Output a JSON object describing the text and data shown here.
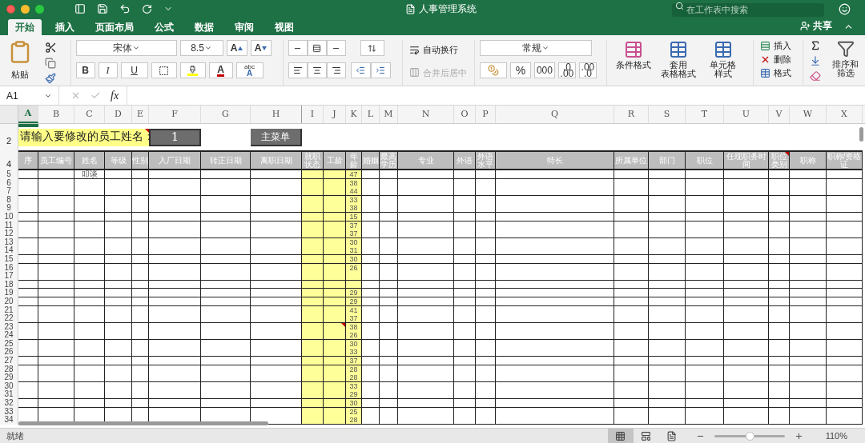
{
  "window": {
    "title": "人事管理系统"
  },
  "search": {
    "placeholder": "在工作表中搜索"
  },
  "tabs": [
    {
      "label": "开始",
      "selected": true
    },
    {
      "label": "插入",
      "selected": false
    },
    {
      "label": "页面布局",
      "selected": false
    },
    {
      "label": "公式",
      "selected": false
    },
    {
      "label": "数据",
      "selected": false
    },
    {
      "label": "审阅",
      "selected": false
    },
    {
      "label": "视图",
      "selected": false
    }
  ],
  "share": "共享",
  "ribbon": {
    "paste": "粘贴",
    "font": "宋体",
    "size": "8.5",
    "grow": "A",
    "shrink": "A",
    "bold": "B",
    "italic": "I",
    "underline": "U",
    "font_color": "A",
    "text_effect": [
      "abc",
      "A"
    ],
    "wrap": "自动换行",
    "merge": {
      "label": "合并后居中",
      "disabled": true
    },
    "number_format": "常规",
    "percent": "%",
    "thousands": "000",
    "decimals": [
      [
        ".0",
        ".00"
      ],
      [
        ".00",
        ".0"
      ]
    ],
    "styles": [
      [
        "条件格式"
      ],
      [
        "套用",
        "表格格式"
      ],
      [
        "单元格",
        "样式"
      ]
    ],
    "cells": [
      "插入",
      "删除",
      "格式"
    ],
    "sort": [
      "排序和",
      "筛选"
    ]
  },
  "formula_bar": {
    "name_box": "A1",
    "fx": "fx"
  },
  "sheet": {
    "columns": [
      {
        "letter": "A",
        "selected": true
      },
      {
        "letter": "B",
        "selected": false
      },
      {
        "letter": "C",
        "selected": false
      },
      {
        "letter": "D",
        "selected": false
      },
      {
        "letter": "E",
        "selected": false
      },
      {
        "letter": "F",
        "selected": false
      },
      {
        "letter": "G",
        "selected": false
      },
      {
        "letter": "H",
        "selected": false
      },
      {
        "letter": "I",
        "selected": false
      },
      {
        "letter": "J",
        "selected": false
      },
      {
        "letter": "K",
        "selected": false
      },
      {
        "letter": "L",
        "selected": false
      },
      {
        "letter": "M",
        "selected": false
      },
      {
        "letter": "N",
        "selected": false
      },
      {
        "letter": "O",
        "selected": false
      },
      {
        "letter": "P",
        "selected": false
      },
      {
        "letter": "Q",
        "selected": false
      },
      {
        "letter": "R",
        "selected": false
      },
      {
        "letter": "S",
        "selected": false
      },
      {
        "letter": "T",
        "selected": false
      },
      {
        "letter": "U",
        "selected": false
      },
      {
        "letter": "V",
        "selected": false
      },
      {
        "letter": "W",
        "selected": false
      },
      {
        "letter": "X",
        "selected": false
      }
    ],
    "row_labels": [
      "2",
      "4"
    ],
    "prompt": {
      "text": "请输入要修改的员工姓名：",
      "comment": true
    },
    "input_value": "1",
    "menu_button": "主菜单",
    "headers": [
      {
        "text": "序",
        "comment": false
      },
      {
        "text": "员工编号",
        "comment": false
      },
      {
        "text": "姓名",
        "comment": false
      },
      {
        "text": "等级",
        "comment": false
      },
      {
        "text": "性别",
        "comment": false
      },
      {
        "text": "入厂日期",
        "comment": false
      },
      {
        "text": "转正日期",
        "comment": false
      },
      {
        "text": "离职日期",
        "comment": false
      },
      {
        "text": "就职状态",
        "comment": false
      },
      {
        "text": "工龄",
        "comment": false
      },
      {
        "text": "年龄",
        "comment": false
      },
      {
        "text": "婚姻",
        "comment": false
      },
      {
        "text": "最高学历",
        "comment": false
      },
      {
        "text": "专业",
        "comment": false
      },
      {
        "text": "外语",
        "comment": false
      },
      {
        "text": "外语水平",
        "comment": false
      },
      {
        "text": "特长",
        "comment": false
      },
      {
        "text": "所属单位",
        "comment": false
      },
      {
        "text": "部门",
        "comment": false
      },
      {
        "text": "职位",
        "comment": false
      },
      {
        "text": "任现职务时间",
        "comment": false
      },
      {
        "text": "职位类别",
        "comment": true
      },
      {
        "text": "职称",
        "comment": false
      },
      {
        "text": "职称/资格证",
        "comment": false
      }
    ],
    "rows": [
      {
        "n": "5",
        "name": "叩谈",
        "age": "47",
        "comment": false
      },
      {
        "n": "6",
        "age": "38",
        "comment": false
      },
      {
        "n": "7",
        "age": "44",
        "comment": false
      },
      {
        "n": "8",
        "age": "33",
        "comment": false
      },
      {
        "n": "9",
        "age": "38",
        "comment": false
      },
      {
        "n": "10",
        "age": "15",
        "comment": false
      },
      {
        "n": "11",
        "age": "37",
        "comment": false
      },
      {
        "n": "12",
        "age": "37",
        "comment": false
      },
      {
        "n": "13",
        "age": "30",
        "comment": false
      },
      {
        "n": "14",
        "age": "31",
        "comment": false
      },
      {
        "n": "15",
        "age": "30",
        "comment": false
      },
      {
        "n": "16",
        "age": "26",
        "comment": false
      },
      {
        "n": "17",
        "comment": false
      },
      {
        "n": "18",
        "comment": false
      },
      {
        "n": "19",
        "age": "29",
        "comment": false
      },
      {
        "n": "20",
        "age": "29",
        "comment": false
      },
      {
        "n": "21",
        "age": "41",
        "comment": false
      },
      {
        "n": "22",
        "age": "37",
        "comment": false
      },
      {
        "n": "23",
        "age": "38",
        "comment": true
      },
      {
        "n": "24",
        "age": "26",
        "comment": false
      },
      {
        "n": "25",
        "age": "30",
        "comment": false
      },
      {
        "n": "26",
        "age": "33",
        "comment": false
      },
      {
        "n": "27",
        "age": "37",
        "comment": false
      },
      {
        "n": "28",
        "age": "28",
        "comment": false
      },
      {
        "n": "29",
        "age": "28",
        "comment": false
      },
      {
        "n": "30",
        "age": "33",
        "comment": false
      },
      {
        "n": "31",
        "age": "29",
        "comment": false
      },
      {
        "n": "32",
        "age": "30",
        "comment": false
      },
      {
        "n": "33",
        "age": "25",
        "comment": false
      },
      {
        "n": "34",
        "age": "28",
        "comment": false
      }
    ]
  },
  "status_bar": {
    "status": "就绪",
    "views": [
      {
        "kind": "normal",
        "selected": true
      },
      {
        "kind": "page_layout",
        "selected": false
      },
      {
        "kind": "page_break",
        "selected": false
      }
    ],
    "zoom": {
      "level": 0.5,
      "reading": "110%"
    }
  }
}
